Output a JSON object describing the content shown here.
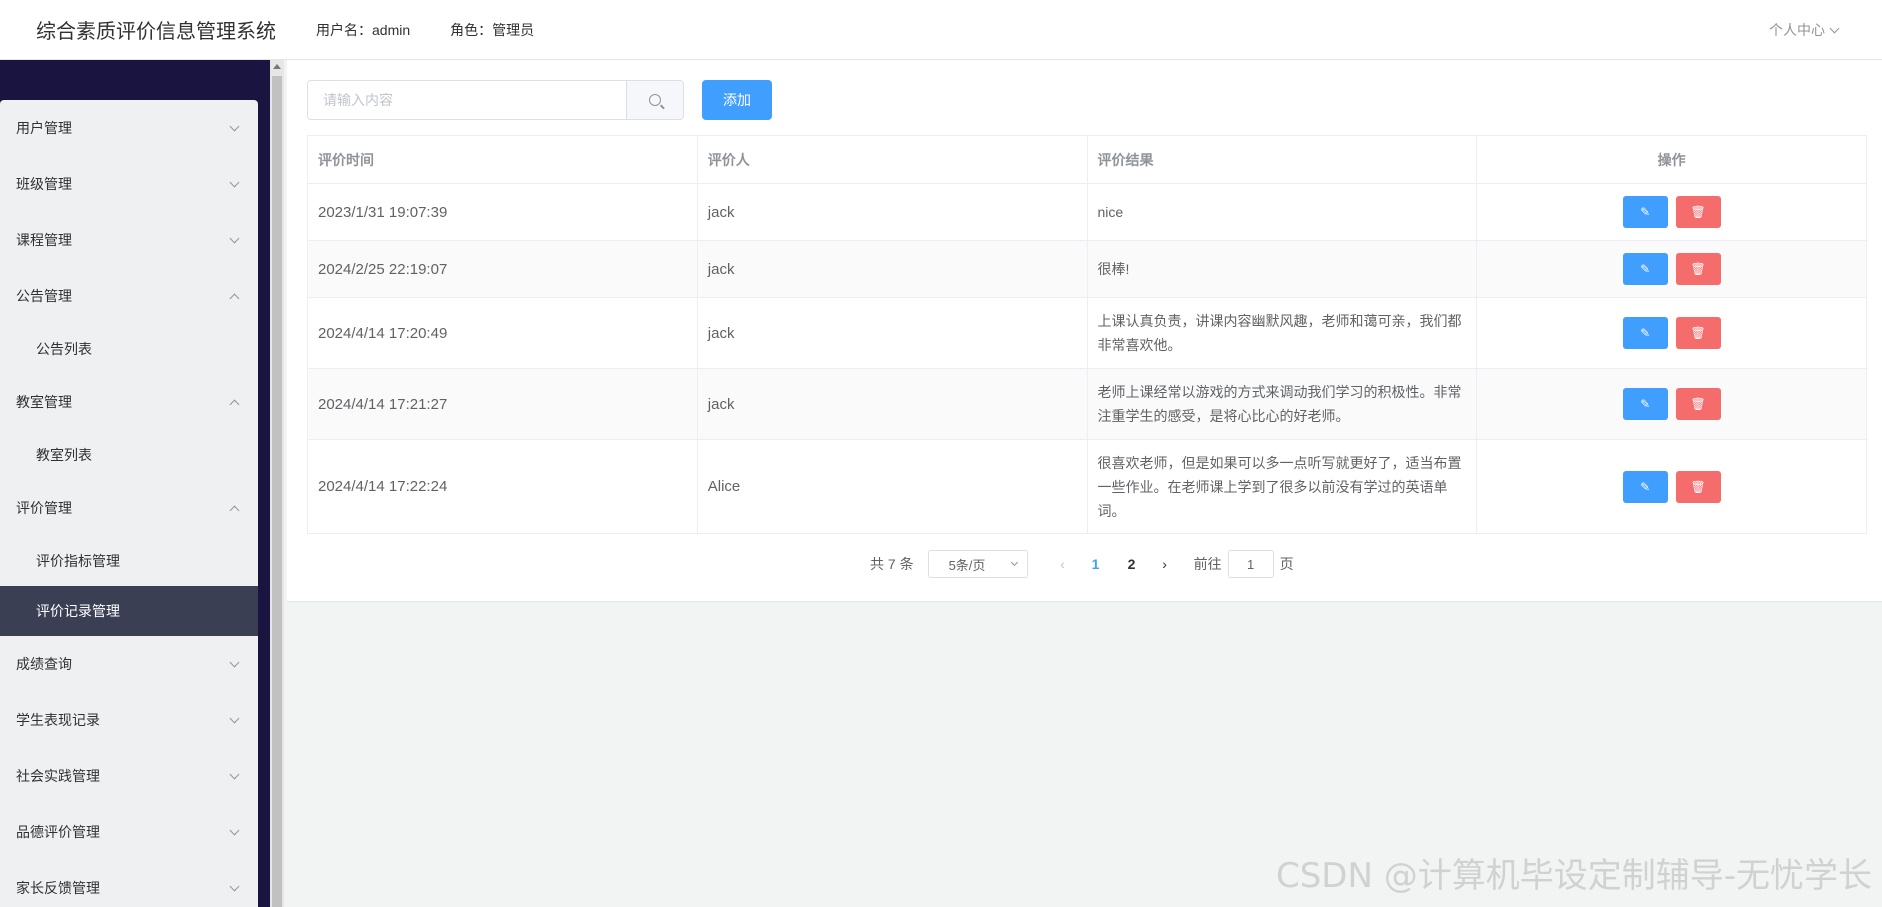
{
  "header": {
    "title": "综合素质评价信息管理系统",
    "user_label": "用户名：admin",
    "role_label": "角色：管理员",
    "personal_center": "个人中心"
  },
  "sidebar": {
    "items": [
      {
        "label": "用户管理",
        "state": "collapsed"
      },
      {
        "label": "班级管理",
        "state": "collapsed"
      },
      {
        "label": "课程管理",
        "state": "collapsed"
      },
      {
        "label": "公告管理",
        "state": "expanded"
      },
      {
        "label": "公告列表",
        "state": "sub"
      },
      {
        "label": "教室管理",
        "state": "expanded"
      },
      {
        "label": "教室列表",
        "state": "sub"
      },
      {
        "label": "评价管理",
        "state": "expanded"
      },
      {
        "label": "评价指标管理",
        "state": "sub"
      },
      {
        "label": "评价记录管理",
        "state": "sub-active"
      },
      {
        "label": "成绩查询",
        "state": "collapsed"
      },
      {
        "label": "学生表现记录",
        "state": "collapsed"
      },
      {
        "label": "社会实践管理",
        "state": "collapsed"
      },
      {
        "label": "品德评价管理",
        "state": "collapsed"
      },
      {
        "label": "家长反馈管理",
        "state": "collapsed"
      }
    ]
  },
  "toolbar": {
    "search_placeholder": "请输入内容",
    "search_value": "",
    "add_label": "添加"
  },
  "table": {
    "headers": [
      "评价时间",
      "评价人",
      "评价结果",
      "操作"
    ],
    "rows": [
      {
        "time": "2023/1/31 19:07:39",
        "evaluator": "jack",
        "result": "nice"
      },
      {
        "time": "2024/2/25 22:19:07",
        "evaluator": "jack",
        "result": "很棒!"
      },
      {
        "time": "2024/4/14 17:20:49",
        "evaluator": "jack",
        "result": "上课认真负责，讲课内容幽默风趣，老师和蔼可亲，我们都非常喜欢他。"
      },
      {
        "time": "2024/4/14 17:21:27",
        "evaluator": "jack",
        "result": "老师上课经常以游戏的方式来调动我们学习的积极性。非常注重学生的感受，是将心比心的好老师。"
      },
      {
        "time": "2024/4/14 17:22:24",
        "evaluator": "Alice",
        "result": "很喜欢老师，但是如果可以多一点听写就更好了，适当布置一些作业。在老师课上学到了很多以前没有学过的英语单词。"
      }
    ]
  },
  "pagination": {
    "total": "共 7 条",
    "page_size": "5条/页",
    "pages": [
      "1",
      "2"
    ],
    "current_page": "1",
    "goto_label": "前往",
    "goto_value": "1",
    "page_suffix": "页"
  },
  "watermark": "CSDN @计算机毕设定制辅导-无忧学长",
  "colors": {
    "primary": "#409eff",
    "danger": "#f56c6c",
    "sidebar_dark": "#1a1440",
    "active_item": "#3a3f54"
  }
}
